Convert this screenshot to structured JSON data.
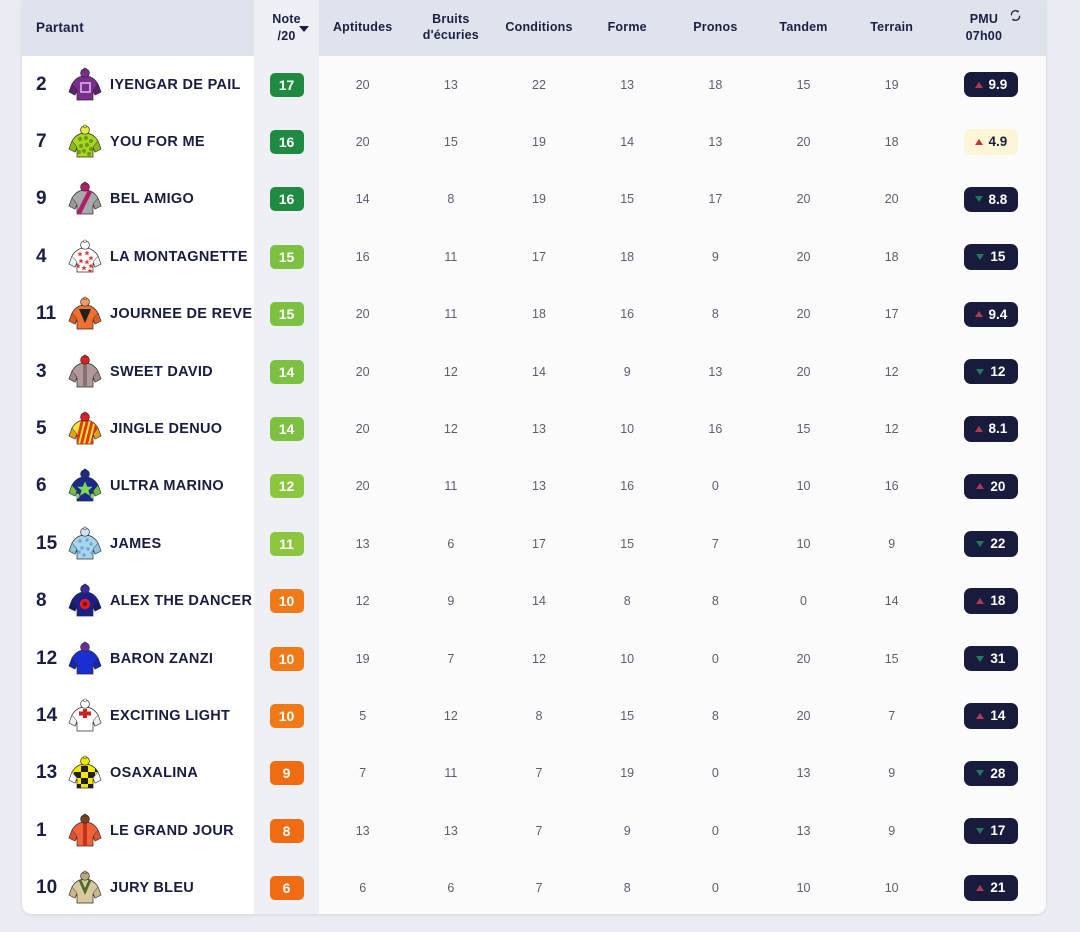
{
  "header": {
    "partant": "Partant",
    "note_line1": "Note",
    "note_line2": "/20",
    "sort_caret": "chevron-down",
    "columns": [
      "Aptitudes",
      "Bruits d'écuries",
      "Conditions",
      "Forme",
      "Pronos",
      "Tandem",
      "Terrain"
    ],
    "col_aptitudes": "Aptitudes",
    "col_bruits_l1": "Bruits",
    "col_bruits_l2": "d'écuries",
    "col_conditions": "Conditions",
    "col_forme": "Forme",
    "col_pronos": "Pronos",
    "col_tandem": "Tandem",
    "col_terrain": "Terrain",
    "pmu_l1": "PMU",
    "pmu_l2": "07h00",
    "refresh_icon": "refresh-icon"
  },
  "colors": {
    "note_17": "#1f8a42",
    "note_16": "#1f8a42",
    "note_15": "#7cc141",
    "note_14": "#7cc141",
    "note_12": "#8cc63f",
    "note_11": "#8cc63f",
    "note_10": "#f07a18",
    "note_9": "#ef6c12",
    "note_8": "#ef6c12",
    "note_6": "#ef6c12",
    "pmu_bg": "#191b3d",
    "pmu_fav_bg": "#fdf6d6",
    "up": "#b03a52",
    "down": "#1f7a62",
    "header_bg": "#dfe3ec",
    "note_col_bg": "#eef0f5",
    "page_bg": "#e9ecf2"
  },
  "rows": [
    {
      "num": "2",
      "name": "IYENGAR DE PAIL",
      "note": "17",
      "note_color": "#1f8a42",
      "silk": {
        "body": "#7b2d8e",
        "sleeve": "#5d1f6e",
        "cap": "#7b2d8e",
        "pattern": "square",
        "accent": "#d9b3e8"
      },
      "values": [
        "20",
        "13",
        "22",
        "13",
        "18",
        "15",
        "19"
      ],
      "pmu": {
        "odds": "9.9",
        "dir": "up",
        "fav": false
      }
    },
    {
      "num": "7",
      "name": "YOU FOR ME",
      "note": "16",
      "note_color": "#1f8a42",
      "silk": {
        "body": "#a8d523",
        "sleeve": "#8cbb18",
        "cap": "#e8ea3d",
        "pattern": "dots",
        "accent": "#6f9c10"
      },
      "values": [
        "20",
        "15",
        "19",
        "14",
        "13",
        "20",
        "18"
      ],
      "pmu": {
        "odds": "4.9",
        "dir": "up",
        "fav": true
      }
    },
    {
      "num": "9",
      "name": "BEL AMIGO",
      "note": "16",
      "note_color": "#1f8a42",
      "silk": {
        "body": "#a9a9a9",
        "sleeve": "#999999",
        "cap": "#b01f6a",
        "pattern": "sash",
        "accent": "#b01f6a"
      },
      "values": [
        "14",
        "8",
        "19",
        "15",
        "17",
        "20",
        "20"
      ],
      "pmu": {
        "odds": "8.8",
        "dir": "down",
        "fav": false
      }
    },
    {
      "num": "4",
      "name": "LA MONTAGNETTE",
      "note": "15",
      "note_color": "#7cc141",
      "silk": {
        "body": "#ffffff",
        "sleeve": "#f2f2f2",
        "cap": "#ffffff",
        "pattern": "stars",
        "accent": "#e03030"
      },
      "values": [
        "16",
        "11",
        "17",
        "18",
        "9",
        "20",
        "18"
      ],
      "pmu": {
        "odds": "15",
        "dir": "down",
        "fav": false
      }
    },
    {
      "num": "11",
      "name": "JOURNEE DE REVE",
      "note": "15",
      "note_color": "#7cc141",
      "silk": {
        "body": "#f07030",
        "sleeve": "#d85f24",
        "cap": "#f09a60",
        "pattern": "chevron",
        "accent": "#202020"
      },
      "values": [
        "20",
        "11",
        "18",
        "16",
        "8",
        "20",
        "17"
      ],
      "pmu": {
        "odds": "9.4",
        "dir": "up",
        "fav": false
      }
    },
    {
      "num": "3",
      "name": "SWEET DAVID",
      "note": "14",
      "note_color": "#7cc141",
      "silk": {
        "body": "#b09a9a",
        "sleeve": "#9e8888",
        "cap": "#e02020",
        "pattern": "stripe-v",
        "accent": "#8b7070"
      },
      "values": [
        "20",
        "12",
        "14",
        "9",
        "13",
        "20",
        "12"
      ],
      "pmu": {
        "odds": "12",
        "dir": "down",
        "fav": false
      }
    },
    {
      "num": "5",
      "name": "JINGLE DENUO",
      "note": "14",
      "note_color": "#7cc141",
      "silk": {
        "body": "#f2e63c",
        "sleeve": "#e0a020",
        "cap": "#e02020",
        "pattern": "stripes-diag",
        "accent": "#e03a10"
      },
      "values": [
        "20",
        "12",
        "13",
        "10",
        "16",
        "15",
        "12"
      ],
      "pmu": {
        "odds": "8.1",
        "dir": "up",
        "fav": false
      }
    },
    {
      "num": "6",
      "name": "ULTRA MARINO",
      "note": "12",
      "note_color": "#8cc63f",
      "silk": {
        "body": "#1b2a8c",
        "sleeve": "#6fbf4a",
        "cap": "#1b2a8c",
        "pattern": "star-big",
        "accent": "#7ed957"
      },
      "values": [
        "20",
        "11",
        "13",
        "16",
        "0",
        "10",
        "16"
      ],
      "pmu": {
        "odds": "20",
        "dir": "up",
        "fav": false
      }
    },
    {
      "num": "15",
      "name": "JAMES",
      "note": "11",
      "note_color": "#8cc63f",
      "silk": {
        "body": "#a8d4ee",
        "sleeve": "#8dc3e4",
        "cap": "#cfe6f5",
        "pattern": "dots-sm",
        "accent": "#6aa8cf"
      },
      "values": [
        "13",
        "6",
        "17",
        "15",
        "7",
        "10",
        "9"
      ],
      "pmu": {
        "odds": "22",
        "dir": "down",
        "fav": false
      }
    },
    {
      "num": "8",
      "name": "ALEX THE DANCER",
      "note": "10",
      "note_color": "#f07a18",
      "silk": {
        "body": "#1b1f8c",
        "sleeve": "#151a70",
        "cap": "#3a2a9e",
        "pattern": "disc",
        "accent": "#e02020"
      },
      "values": [
        "12",
        "9",
        "14",
        "8",
        "8",
        "0",
        "14"
      ],
      "pmu": {
        "odds": "18",
        "dir": "up",
        "fav": false
      }
    },
    {
      "num": "12",
      "name": "BARON ZANZI",
      "note": "10",
      "note_color": "#f07a18",
      "silk": {
        "body": "#1a2fd0",
        "sleeve": "#1527b0",
        "cap": "#6b2d9e",
        "pattern": "plain",
        "accent": "#1527b0"
      },
      "values": [
        "19",
        "7",
        "12",
        "10",
        "0",
        "20",
        "15"
      ],
      "pmu": {
        "odds": "31",
        "dir": "down",
        "fav": false
      }
    },
    {
      "num": "14",
      "name": "EXCITING LIGHT",
      "note": "10",
      "note_color": "#f07a18",
      "silk": {
        "body": "#ffffff",
        "sleeve": "#f0f0f0",
        "cap": "#ffffff",
        "pattern": "cross",
        "accent": "#d02020"
      },
      "values": [
        "5",
        "12",
        "8",
        "15",
        "8",
        "20",
        "7"
      ],
      "pmu": {
        "odds": "14",
        "dir": "up",
        "fav": false
      }
    },
    {
      "num": "13",
      "name": "OSAXALINA",
      "note": "9",
      "note_color": "#ef6c12",
      "silk": {
        "body": "#f5e800",
        "sleeve": "#ffffff",
        "cap": "#f5e800",
        "pattern": "checks",
        "accent": "#202020"
      },
      "values": [
        "7",
        "11",
        "7",
        "19",
        "0",
        "13",
        "9"
      ],
      "pmu": {
        "odds": "28",
        "dir": "down",
        "fav": false
      }
    },
    {
      "num": "1",
      "name": "LE GRAND JOUR",
      "note": "8",
      "note_color": "#ef6c12",
      "silk": {
        "body": "#f2623c",
        "sleeve": "#df5230",
        "cap": "#7a4020",
        "pattern": "stripe-v",
        "accent": "#c4341a"
      },
      "values": [
        "13",
        "13",
        "7",
        "9",
        "0",
        "13",
        "9"
      ],
      "pmu": {
        "odds": "17",
        "dir": "down",
        "fav": false
      }
    },
    {
      "num": "10",
      "name": "JURY BLEU",
      "note": "6",
      "note_color": "#ef6c12",
      "silk": {
        "body": "#d8c9a0",
        "sleeve": "#c8b88c",
        "cap": "#b8a878",
        "pattern": "vee",
        "accent": "#4a6b2a"
      },
      "values": [
        "6",
        "6",
        "7",
        "8",
        "0",
        "10",
        "10"
      ],
      "pmu": {
        "odds": "21",
        "dir": "up",
        "fav": false
      }
    }
  ]
}
